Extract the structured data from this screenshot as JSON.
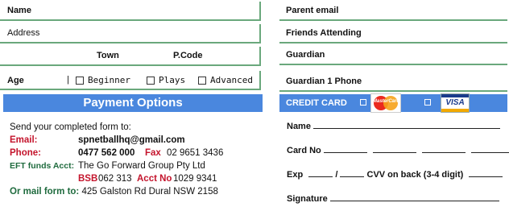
{
  "left_form": {
    "name_label": "Name",
    "address_label": "Address",
    "town_label": "Town",
    "pcode_label": "P.Code",
    "age_label": "Age",
    "age_separator": "|",
    "options": [
      "Beginner",
      "Plays",
      "Advanced"
    ]
  },
  "payment": {
    "title": "Payment Options",
    "send_text": "Send your completed form to:",
    "email_label": "Email:",
    "email_value": "spnetballhq@gmail.com",
    "phone_label": "Phone:",
    "phone_value": "0477 562 000",
    "fax_label": "Fax",
    "fax_value": "02 9651 3436",
    "eft_label": "EFT funds Acct:",
    "eft_value": "The Go Forward Group Pty Ltd",
    "bsb_label": "BSB",
    "bsb_value": "062 313",
    "acct_label": "Acct No",
    "acct_value": "1029 9341",
    "mail_label": "Or mail  form to:",
    "mail_value": "425 Galston Rd Dural NSW 2158"
  },
  "right_form": {
    "parent_email_label": "Parent email",
    "friends_label": "Friends Attending",
    "guardian_label": "Guardian",
    "guardian_phone_label": "Guardian 1 Phone"
  },
  "credit_card": {
    "title": "CREDIT CARD",
    "mastercard_text": "MasterCard",
    "visa_text": "VISA",
    "name_label": "Name",
    "card_no_label": "Card No",
    "exp_label": "Exp",
    "exp_sep": "/",
    "cvv_label": "CVV on back (3-4 digit)",
    "signature_label": "Signature"
  },
  "colors": {
    "accent_blue": "#4a87de",
    "rule_green": "#6aa87c",
    "red": "#c4142c",
    "green": "#1f6b3e"
  }
}
